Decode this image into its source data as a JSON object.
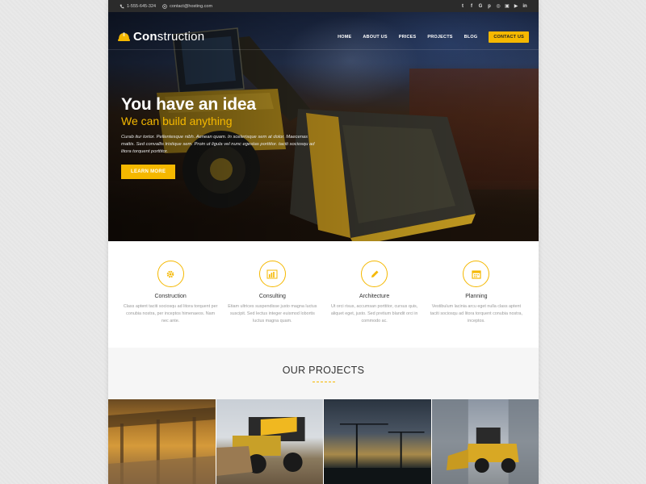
{
  "colors": {
    "accent": "#f5b800",
    "topbar": "#2b2b2b",
    "text": "#333333"
  },
  "topbar": {
    "phone": "1-555-645-324",
    "email": "contact@hosting.com",
    "social_icons": [
      "twitter-icon",
      "facebook-icon",
      "google-plus-icon",
      "pinterest-icon",
      "dribbble-icon",
      "instagram-icon",
      "youtube-icon",
      "linkedin-icon"
    ]
  },
  "nav": {
    "logo_bold": "Con",
    "logo_rest": "struction",
    "items": [
      "HOME",
      "ABOUT US",
      "PRICES",
      "PROJECTS",
      "BLOG"
    ],
    "cta": "CONTACT US"
  },
  "hero": {
    "title": "You have an idea",
    "subtitle": "We can build anything",
    "text": "Curab itur tortor. Pellentesque nibh. Aenean quam. In scelerisque sem at dolor. Maecenas mattis. Sed convallis tristique sem. Proin ut ligula vel nunc egestas porttitor. Morbi lectus risus, iaculis vel, suscipit quis, luctus non, massa. Fusce ac turpis quis ligula lacinia aliquet. Mauris ipsum. Nulla metus metus, ullamcorper vel, tincidunt sed, euismod in, nibh. Quisque volutpat condimentum velit. Class aptent taciti sociosqu ad litora torquent porttitor.",
    "text_short": "Curab itur tortor. Pellentesque nibh. Aenean quam. In scelerisque sem at dolor. Maecenas mattis. Sed convallis tristique sem. Proin ut ligula vel nunc egestas porttitor. taciti sociosqu ad litora torquent porttitor.",
    "button": "LEARN MORE"
  },
  "services": [
    {
      "icon": "gear-icon",
      "title": "Construction",
      "text": "Class aptent taciti sociosqu ad litora torquent per conubia nostra, per inceptos himenaeos. Nam nec ante."
    },
    {
      "icon": "bar-chart-icon",
      "title": "Consulting",
      "text": "Etiam ultrices suspendisse justo magna luctus suscipit. Sed lectus integer euismod lobortis luctus magna quam."
    },
    {
      "icon": "pencil-icon",
      "title": "Architecture",
      "text": "Ut orci risus, accumsan porttitor, cursus quis, aliquet eget, justo. Sed pretium blandit orci in commodo ac."
    },
    {
      "icon": "calendar-icon",
      "title": "Planning",
      "text": "Vestibulum lacinia arcu eget nulla class aptent taciti sociosqu ad litora torquent conubia nostra, inceptos."
    }
  ],
  "projects": {
    "heading": "OUR PROJECTS"
  }
}
